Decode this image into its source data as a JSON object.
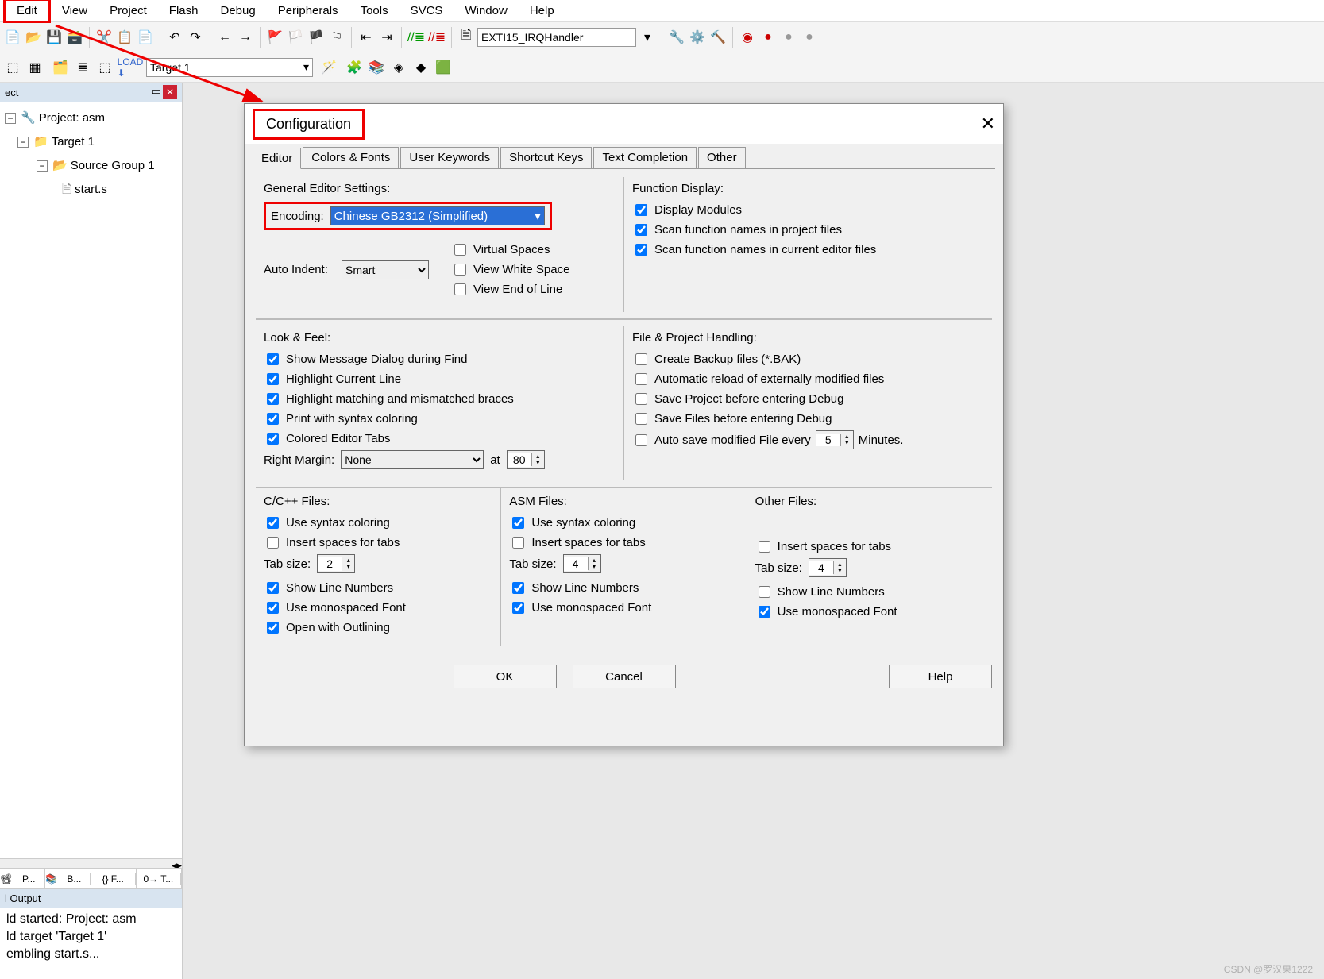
{
  "menu": [
    "Edit",
    "View",
    "Project",
    "Flash",
    "Debug",
    "Peripherals",
    "Tools",
    "SVCS",
    "Window",
    "Help"
  ],
  "irq_handler": "EXTI15_IRQHandler",
  "target_combo": "Target 1",
  "sidebar": {
    "title": "ect",
    "project": "Project: asm",
    "target": "Target 1",
    "group": "Source Group 1",
    "file": "start.s"
  },
  "side_tabs": [
    "P...",
    "B...",
    "{} F...",
    "0→ T..."
  ],
  "output_title": "l Output",
  "output_lines": [
    "ld started: Project: asm",
    "ld target 'Target 1'",
    "embling start.s..."
  ],
  "dialog": {
    "title": "Configuration",
    "tabs": [
      "Editor",
      "Colors & Fonts",
      "User Keywords",
      "Shortcut Keys",
      "Text Completion",
      "Other"
    ],
    "general_title": "General Editor Settings:",
    "encoding_label": "Encoding:",
    "encoding_value": "Chinese GB2312 (Simplified)",
    "auto_indent_label": "Auto Indent:",
    "auto_indent_value": "Smart",
    "virtual_spaces": "Virtual Spaces",
    "view_white": "View White Space",
    "view_eol": "View End of Line",
    "func_title": "Function Display:",
    "func_items": [
      "Display Modules",
      "Scan function names in project files",
      "Scan function names in current editor files"
    ],
    "look_title": "Look & Feel:",
    "look_items": [
      "Show Message Dialog during Find",
      "Highlight Current Line",
      "Highlight matching and mismatched braces",
      "Print with syntax coloring",
      "Colored Editor Tabs"
    ],
    "right_margin_label": "Right Margin:",
    "right_margin_value": "None",
    "at_label": "at",
    "at_value": "80",
    "fph_title": "File & Project Handling:",
    "fph_items": [
      "Create Backup files (*.BAK)",
      "Automatic reload of externally modified files",
      "Save Project before entering Debug",
      "Save Files before entering Debug"
    ],
    "autosave_label": "Auto save modified File every",
    "autosave_value": "5",
    "autosave_unit": "Minutes.",
    "cc_title": "C/C++ Files:",
    "asm_title": "ASM Files:",
    "other_title": "Other Files:",
    "syntax": "Use syntax coloring",
    "spaces": "Insert spaces for tabs",
    "tabsize_label": "Tab size:",
    "cc_tab": "2",
    "asm_tab": "4",
    "other_tab": "4",
    "show_ln": "Show Line Numbers",
    "mono": "Use monospaced Font",
    "outline": "Open with Outlining",
    "ok": "OK",
    "cancel": "Cancel",
    "help": "Help"
  },
  "watermark": "CSDN @罗汉果1222"
}
